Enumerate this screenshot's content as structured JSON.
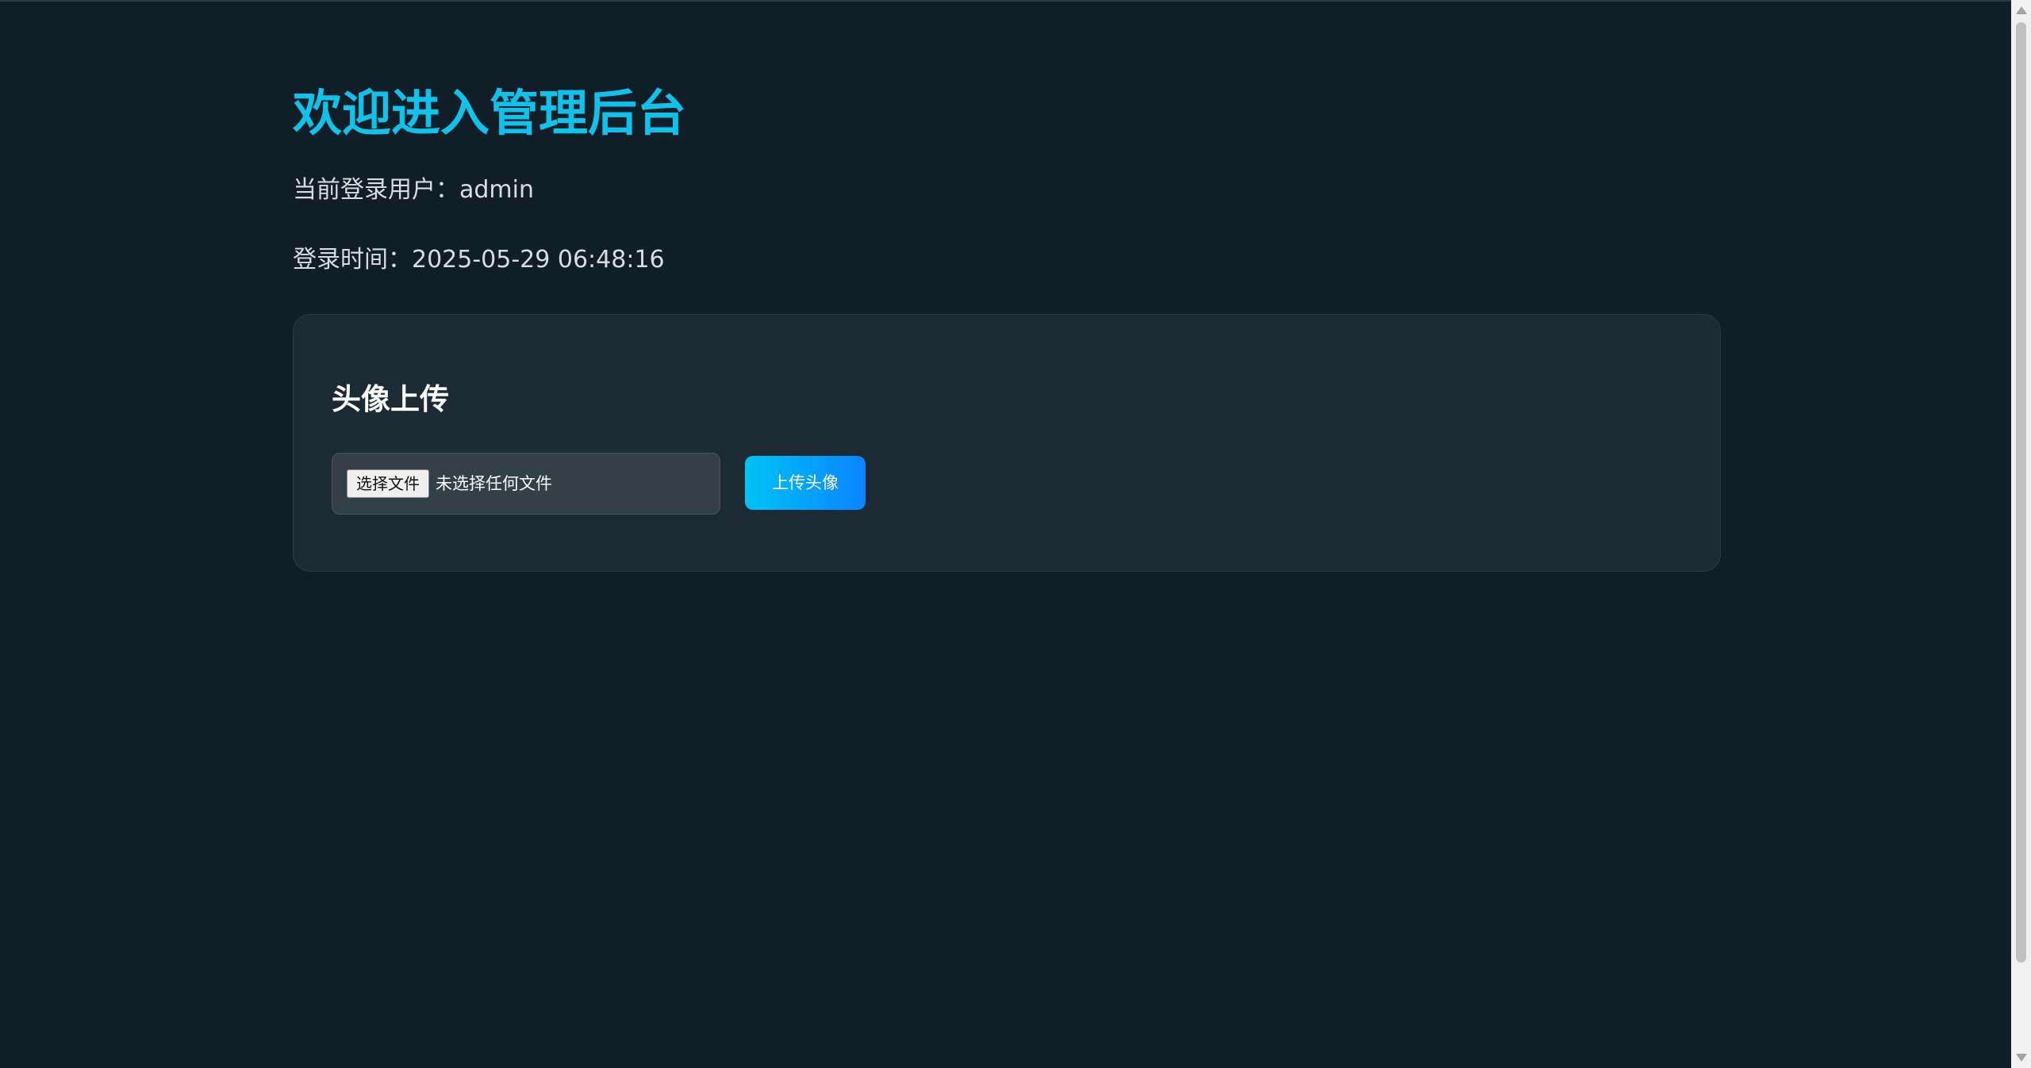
{
  "header": {
    "title": "欢迎进入管理后台",
    "user_line": "当前登录用户：admin",
    "time_line": "登录时间：2025-05-29 06:48:16"
  },
  "avatar_upload": {
    "title": "头像上传",
    "choose_file_label": "选择文件",
    "file_status": "未选择任何文件",
    "upload_button_label": "上传头像"
  },
  "colors": {
    "background": "#101f27",
    "card": "#1b2a33",
    "accent_title": "#10c2ea",
    "button_gradient_start": "#00c3f5",
    "button_gradient_end": "#0a84ff"
  }
}
